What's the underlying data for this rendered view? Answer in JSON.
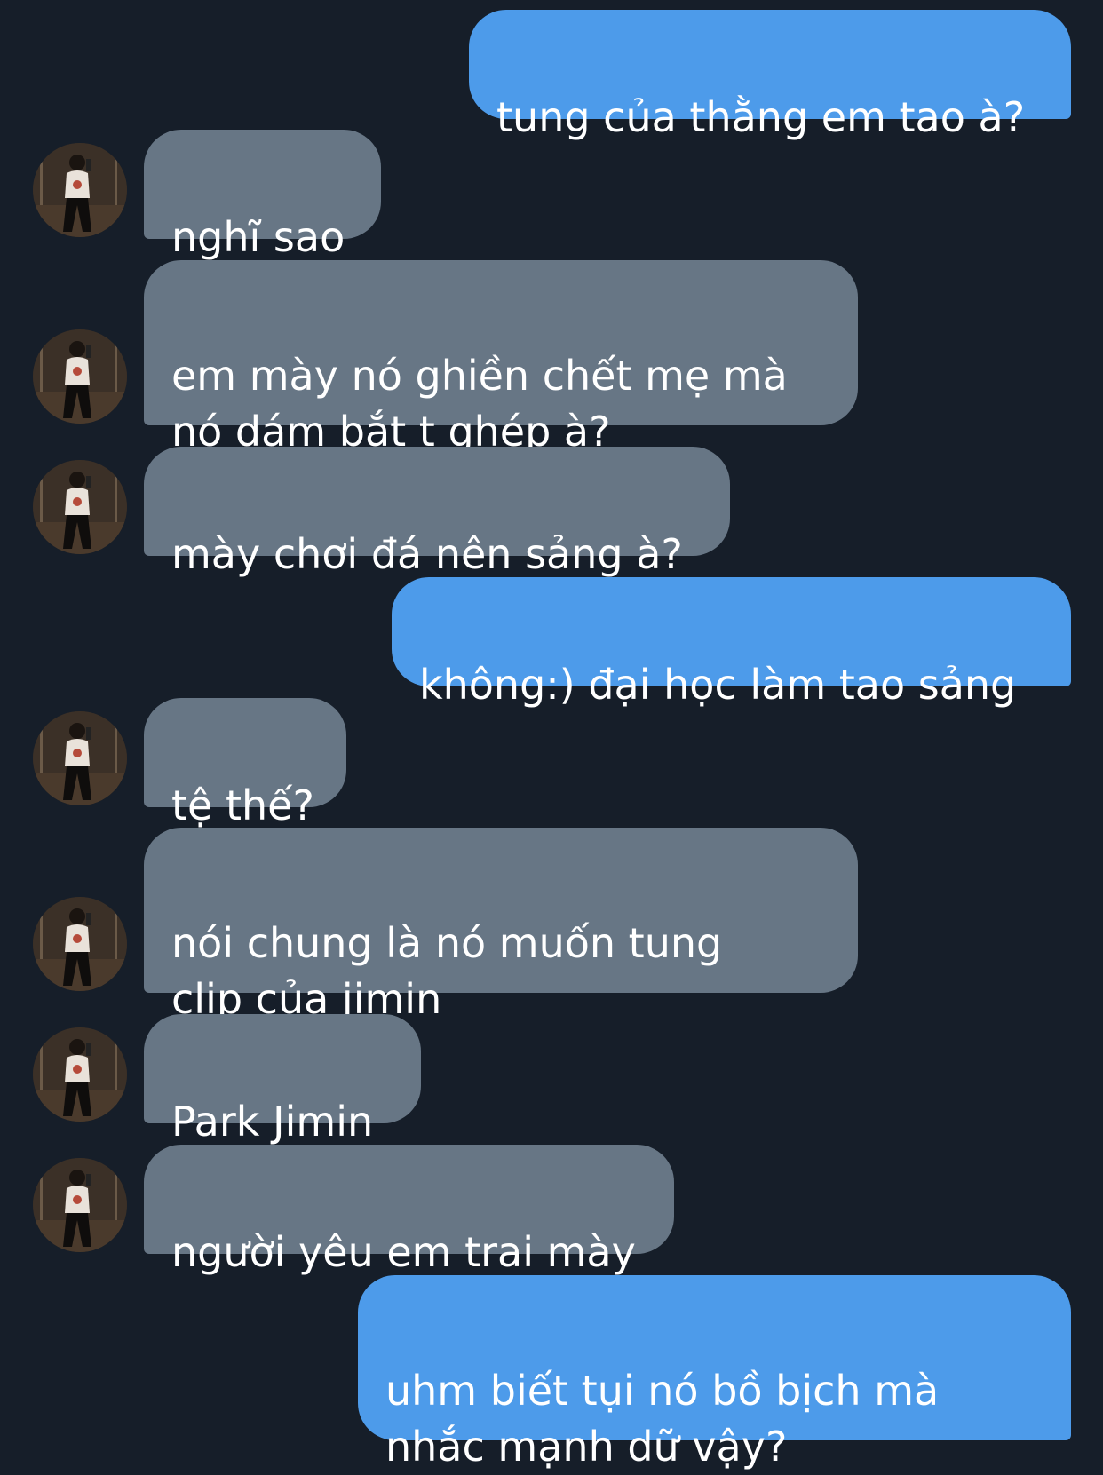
{
  "messages": [
    {
      "direction": "outgoing",
      "text": "tung của thằng em tao à?"
    },
    {
      "direction": "incoming",
      "text": "nghĩ sao",
      "avatar": "contact-avatar"
    },
    {
      "direction": "incoming",
      "text": "em mày nó ghiền chết mẹ mà\nnó dám bắt t ghép à?",
      "avatar": "contact-avatar"
    },
    {
      "direction": "incoming",
      "text": "mày chơi đá nên sảng à?",
      "avatar": "contact-avatar"
    },
    {
      "direction": "outgoing",
      "text": "không:) đại học làm tao sảng"
    },
    {
      "direction": "incoming",
      "text": "tệ thế?",
      "avatar": "contact-avatar"
    },
    {
      "direction": "incoming",
      "text": "nói chung là nó muốn tung\nclip của jimin",
      "avatar": "contact-avatar"
    },
    {
      "direction": "incoming",
      "text": "Park Jimin",
      "avatar": "contact-avatar"
    },
    {
      "direction": "incoming",
      "text": "người yêu em trai mày",
      "avatar": "contact-avatar"
    },
    {
      "direction": "outgoing",
      "text": "uhm biết tụi nó bồ bịch mà\nnhắc mạnh dữ vậy?"
    }
  ],
  "colors": {
    "background": "#161e29",
    "outgoing_bubble": "#4d9bea",
    "incoming_bubble": "#677685",
    "text": "#ffffff"
  }
}
